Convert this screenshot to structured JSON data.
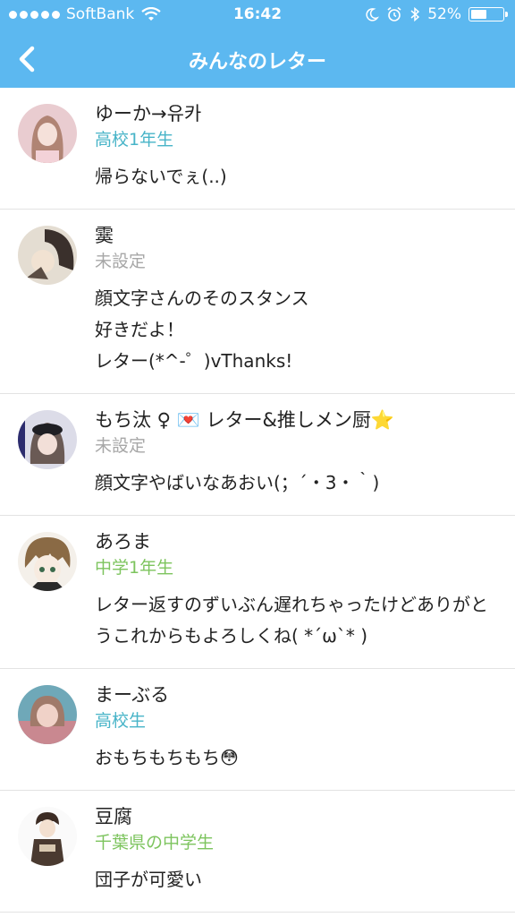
{
  "status": {
    "carrier": "SoftBank",
    "time": "16:42",
    "battery": "52%",
    "battery_level": 0.52
  },
  "nav": {
    "title": "みんなのレター"
  },
  "letters": [
    {
      "name": "ゆーか→유카",
      "grade": "高校1年生",
      "message": "帰らないでぇ(..)"
    },
    {
      "name": "霙",
      "grade": "未設定",
      "message": "顔文字さんのそのスタンス\n好きだよ！\nレター(*^-゜)vThanks!"
    },
    {
      "name": "もち汰 ♀ 💌 レター&推しメン厨⭐",
      "grade": "未設定",
      "message": "顔文字やばいなあおい(；´・3・｀)"
    },
    {
      "name": "あろま",
      "grade": "中学1年生",
      "message": "レター返すのずいぶん遅れちゃったけどありがとうこれからもよろしくね( *´ω`* )"
    },
    {
      "name": "まーぶる",
      "grade": "高校生",
      "message": "おもちもちもち😳"
    },
    {
      "name": "豆腐",
      "grade": "千葉県の中学生",
      "message": "団子が可愛い"
    }
  ]
}
